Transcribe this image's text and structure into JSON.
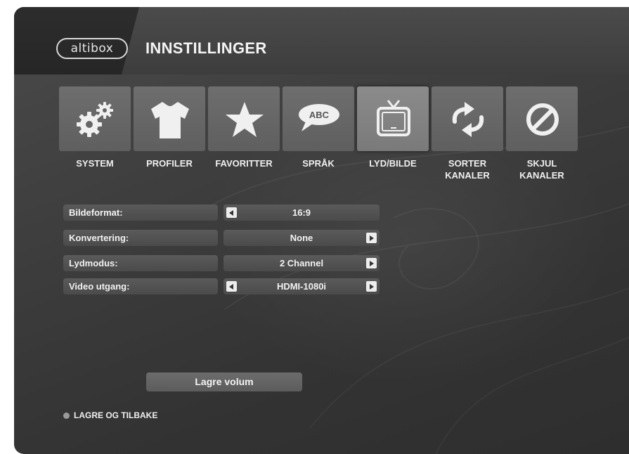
{
  "header": {
    "logo_text": "altibox",
    "title": "INNSTILLINGER"
  },
  "menu": {
    "items": [
      {
        "label": "SYSTEM",
        "icon": "gears-icon"
      },
      {
        "label": "PROFILER",
        "icon": "tshirt-icon"
      },
      {
        "label": "FAVORITTER",
        "icon": "star-icon"
      },
      {
        "label": "SPRÅK",
        "icon": "speech-bubble-icon",
        "icon_text": "ABC"
      },
      {
        "label": "LYD/BILDE",
        "icon": "tv-icon",
        "selected": true
      },
      {
        "label": "SORTER\nKANALER",
        "icon": "sort-arrows-icon"
      },
      {
        "label": "SKJUL\nKANALER",
        "icon": "prohibited-icon"
      }
    ]
  },
  "settings": [
    {
      "label": "Bildeformat:",
      "value": "16:9",
      "left_arrow": true,
      "right_arrow": false
    },
    {
      "label": "Konvertering:",
      "value": "None",
      "left_arrow": false,
      "right_arrow": true
    },
    {
      "label": "Lydmodus:",
      "value": "2 Channel",
      "left_arrow": false,
      "right_arrow": true
    },
    {
      "label": "Video utgang:",
      "value": "HDMI-1080i",
      "left_arrow": true,
      "right_arrow": true
    }
  ],
  "save_volume_label": "Lagre volum",
  "footer": {
    "back_label": "LAGRE OG TILBAKE",
    "dot_color": "#9a9a9a"
  },
  "colors": {
    "tile": "#666666",
    "tile_selected": "#828282",
    "text": "#f0f0f0"
  }
}
